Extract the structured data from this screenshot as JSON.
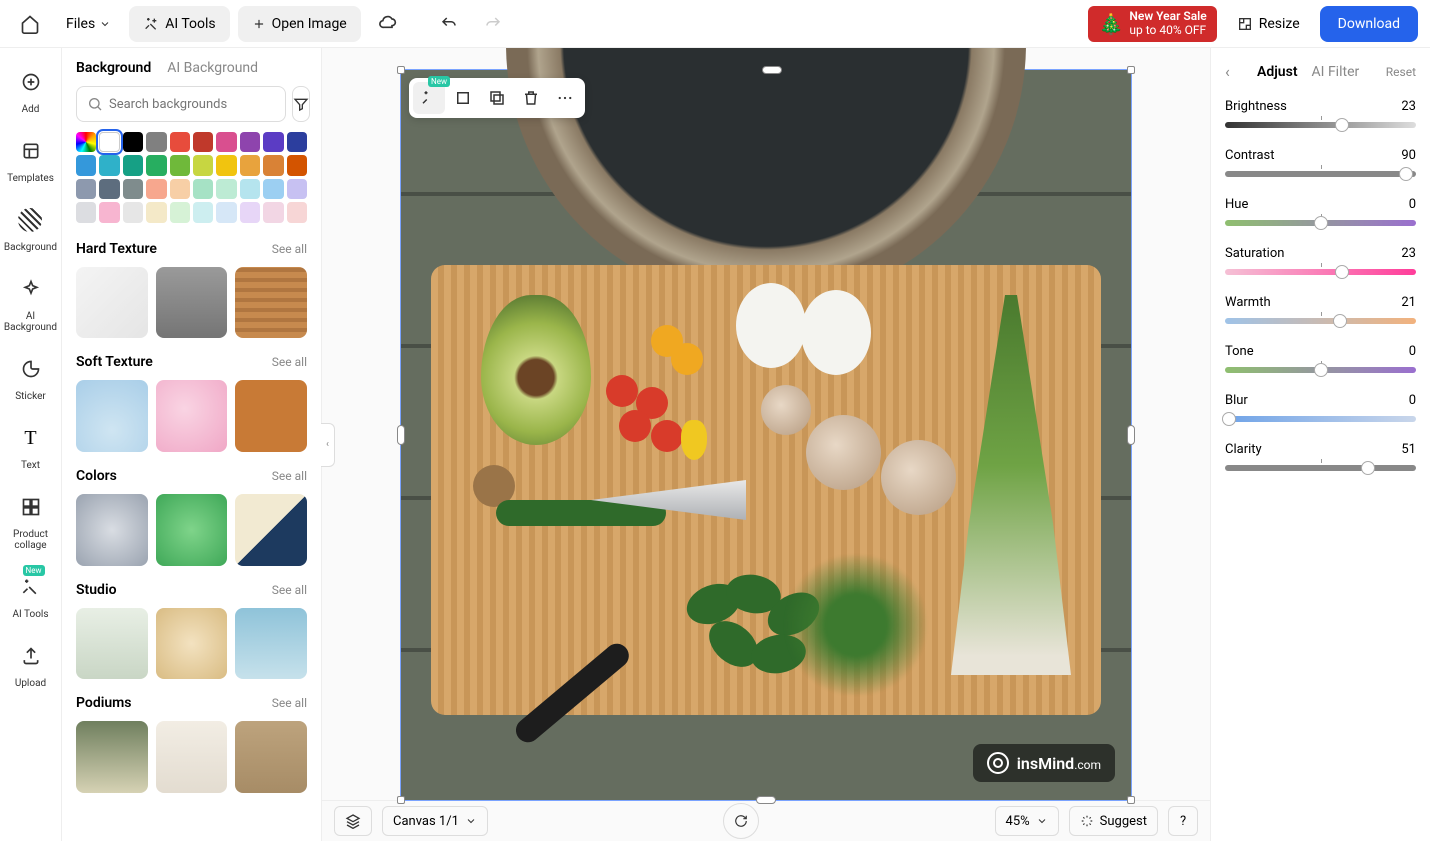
{
  "topbar": {
    "files": "Files",
    "ai_tools": "AI Tools",
    "open_image": "Open Image",
    "sale_line1": "New Year Sale",
    "sale_line2": "up to 40% OFF",
    "resize": "Resize",
    "download": "Download"
  },
  "leftnav": {
    "items": [
      {
        "label": "Add"
      },
      {
        "label": "Templates"
      },
      {
        "label": "Background"
      },
      {
        "label": "AI Background"
      },
      {
        "label": "Sticker"
      },
      {
        "label": "Text"
      },
      {
        "label": "Product collage"
      },
      {
        "label": "AI Tools"
      },
      {
        "label": "Upload"
      }
    ],
    "badge": "New"
  },
  "leftpanel": {
    "tab_background": "Background",
    "tab_ai_background": "AI Background",
    "search_placeholder": "Search backgrounds",
    "see_all": "See all",
    "sections": {
      "hard_texture": "Hard Texture",
      "soft_texture": "Soft Texture",
      "colors": "Colors",
      "studio": "Studio",
      "podiums": "Podiums"
    },
    "swatches": [
      "rainbow",
      "#ffffff",
      "#000000",
      "#808080",
      "#e74c3c",
      "#c0392b",
      "#d94f8f",
      "#8e44ad",
      "#5b3cc4",
      "#2c3e9e",
      "#3498db",
      "#2fb1c9",
      "#16a085",
      "#27ae60",
      "#6fb93a",
      "#c7d641",
      "#f1c40f",
      "#e8a33d",
      "#d98236",
      "#d35400",
      "#8d99ae",
      "#5d6d7e",
      "#7f8c8d",
      "#f7a78e",
      "#f7cfa6",
      "#a6e2c5",
      "#bdebd4",
      "#b5e4ee",
      "#9ccff2",
      "#c7c1f2",
      "#dcdde1",
      "#f7b5d0",
      "#e6e6e6",
      "#f4e9c8",
      "#d6f2d6",
      "#cdeef0",
      "#d6e7f7",
      "#e7d6f7",
      "#f2d6e4",
      "#f7d6d6"
    ]
  },
  "canvas": {
    "watermark_brand": "insMind",
    "watermark_suffix": ".com",
    "toolbar_badge": "New"
  },
  "bottombar": {
    "canvas_label": "Canvas 1/1",
    "zoom": "45%",
    "suggest": "Suggest",
    "help": "?"
  },
  "rightpanel": {
    "tab_adjust": "Adjust",
    "tab_ai_filter": "AI Filter",
    "reset": "Reset",
    "sliders": [
      {
        "label": "Brightness",
        "value": 23,
        "min": -100,
        "max": 100,
        "pos": 61,
        "grad": "linear-gradient(90deg,#333,#ddd)"
      },
      {
        "label": "Contrast",
        "value": 90,
        "min": -100,
        "max": 100,
        "pos": 95,
        "grad": "linear-gradient(90deg,#888,#888)"
      },
      {
        "label": "Hue",
        "value": 0,
        "min": -100,
        "max": 100,
        "pos": 50,
        "grad": "linear-gradient(90deg,#8fbf6f,#9a6fcf)"
      },
      {
        "label": "Saturation",
        "value": 23,
        "min": -100,
        "max": 100,
        "pos": 61,
        "grad": "linear-gradient(90deg,#f5c0d5,#ff3d9a)"
      },
      {
        "label": "Warmth",
        "value": 21,
        "min": -100,
        "max": 100,
        "pos": 60,
        "grad": "linear-gradient(90deg,#9fc3e8,#f2b27d)"
      },
      {
        "label": "Tone",
        "value": 0,
        "min": -100,
        "max": 100,
        "pos": 50,
        "grad": "linear-gradient(90deg,#8fbf6f,#9a6fcf)"
      },
      {
        "label": "Blur",
        "value": 0,
        "min": 0,
        "max": 100,
        "pos": 2,
        "grad": "linear-gradient(90deg,#6fa3e8,#c9d6ea)"
      },
      {
        "label": "Clarity",
        "value": 51,
        "min": -100,
        "max": 100,
        "pos": 75,
        "grad": "linear-gradient(90deg,#888,#888)"
      }
    ]
  }
}
